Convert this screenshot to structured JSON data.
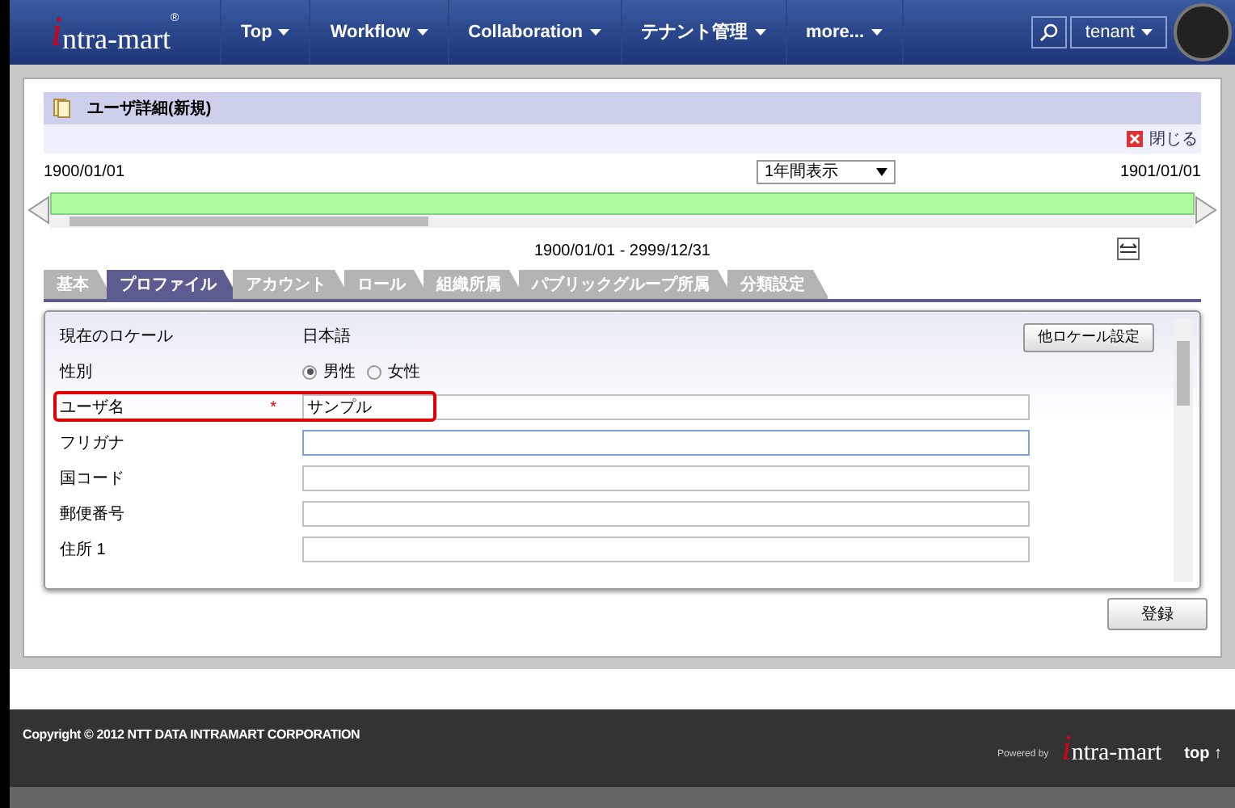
{
  "header": {
    "logo_initial": "i",
    "logo": "ntra-mart",
    "logo_mark": "®",
    "nav": [
      "Top",
      "Workflow",
      "Collaboration",
      "テナント管理",
      "more..."
    ],
    "user": "tenant"
  },
  "page_title": "ユーザ詳細(新規)",
  "close": "閉じる",
  "timeline": {
    "start": "1900/01/01",
    "end": "1901/01/01",
    "period": "1年間表示",
    "range": "1900/01/01 - 2999/12/31"
  },
  "tabs": [
    {
      "label": "基本",
      "selected": false
    },
    {
      "label": "プロファイル",
      "selected": true
    },
    {
      "label": "アカウント",
      "selected": false
    },
    {
      "label": "ロール",
      "selected": false
    },
    {
      "label": "組織所属",
      "selected": false
    },
    {
      "label": "パブリックグループ所属",
      "selected": false
    },
    {
      "label": "分類設定",
      "selected": false
    }
  ],
  "locale_button": "他ロケール設定",
  "fields": [
    {
      "kind": "text",
      "label": "現在のロケール",
      "value": "日本語"
    },
    {
      "kind": "radio",
      "label": "性別",
      "options": [
        {
          "label": "男性",
          "selected": true
        },
        {
          "label": "女性",
          "selected": false
        }
      ]
    },
    {
      "kind": "input",
      "label": "ユーザ名",
      "required": true,
      "highlighted": true,
      "value": "サンプル",
      "focused": false
    },
    {
      "kind": "input",
      "label": "フリガナ",
      "required": false,
      "highlighted": false,
      "focused": true
    },
    {
      "kind": "input",
      "label": "国コード",
      "required": false,
      "highlighted": false,
      "focused": false
    },
    {
      "kind": "input",
      "label": "郵便番号",
      "required": false,
      "highlighted": false,
      "focused": false
    },
    {
      "kind": "input",
      "label": "住所 1",
      "required": false,
      "highlighted": false,
      "focused": false
    }
  ],
  "required_mark": "*",
  "submit": "登録",
  "footer": {
    "copyright": "Copyright © 2012 NTT DATA INTRAMART CORPORATION",
    "powered": "Powered by",
    "logo_initial": "i",
    "logo": "ntra-mart",
    "top": "top ↑"
  }
}
